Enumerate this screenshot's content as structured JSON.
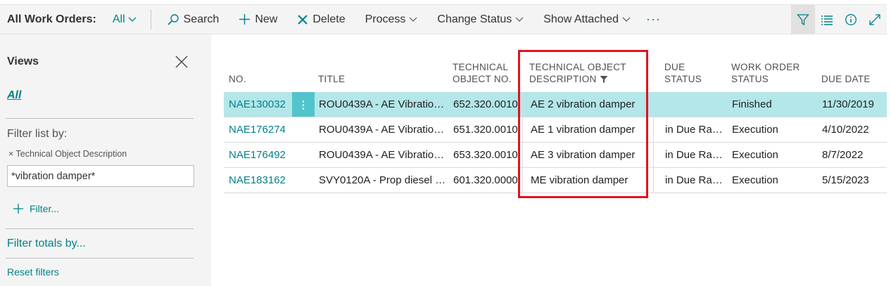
{
  "toolbar": {
    "title": "All Work Orders:",
    "view": "All",
    "actions": {
      "search": "Search",
      "new": "New",
      "delete": "Delete",
      "process": "Process",
      "change_status": "Change Status",
      "show_attached": "Show Attached"
    },
    "more": "···"
  },
  "pane": {
    "title": "Views",
    "all_view": "All",
    "filter_list_by": "Filter list by:",
    "active_filter_field": "× Technical Object Description",
    "filter_value": "*vibration damper*",
    "add_filter": "Filter...",
    "filter_totals": "Filter totals by...",
    "reset": "Reset filters"
  },
  "grid": {
    "headers": {
      "no": "NO.",
      "title": "TITLE",
      "tech_obj_no_1": "TECHNICAL",
      "tech_obj_no_2": "OBJECT NO.",
      "tech_obj_desc_1": "TECHNICAL OBJECT",
      "tech_obj_desc_2": "DESCRIPTION",
      "due_status_1": "DUE",
      "due_status_2": "STATUS",
      "wo_status_1": "WORK ORDER",
      "wo_status_2": "STATUS",
      "due_date": "DUE DATE"
    },
    "rows": [
      {
        "no": "NAE130032",
        "title": "ROU0439A - AE Vibration ...",
        "tech_obj_no": "652.320.0010",
        "description": "AE 2 vibration damper",
        "due_status": "",
        "status": "Finished",
        "due_date": "11/30/2019"
      },
      {
        "no": "NAE176274",
        "title": "ROU0439A - AE Vibration ...",
        "tech_obj_no": "651.320.0010",
        "description": "AE 1 vibration damper",
        "due_status": "in Due Ran...",
        "status": "Execution",
        "due_date": "4/10/2022"
      },
      {
        "no": "NAE176492",
        "title": "ROU0439A - AE Vibration ...",
        "tech_obj_no": "653.320.0010",
        "description": "AE 3 vibration damper",
        "due_status": "in Due Ran...",
        "status": "Execution",
        "due_date": "8/7/2022"
      },
      {
        "no": "NAE183162",
        "title": "SVY0120A - Prop diesel e...",
        "tech_obj_no": "601.320.0000",
        "description": "ME vibration damper",
        "due_status": "in Due Ran...",
        "status": "Execution",
        "due_date": "5/15/2023"
      }
    ],
    "row_menu": "⋮"
  },
  "colors": {
    "accent": "#00818a",
    "selected_row": "#b3e7e9",
    "highlight_box": "#e0141c"
  }
}
